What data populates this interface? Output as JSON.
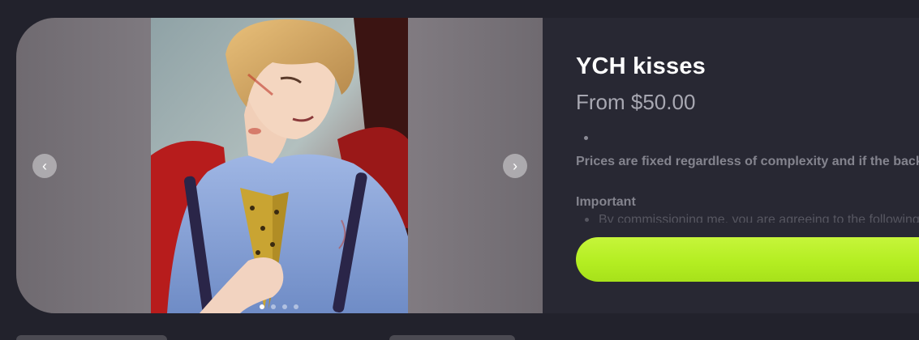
{
  "product": {
    "title": "YCH kisses",
    "price": "From $50.00",
    "description": "Prices are fixed regardless of complexity and if the background is",
    "important_heading": "Important",
    "terms_preview": "By commissioning me, you are agreeing to the following terms"
  },
  "gallery": {
    "prev_icon": "‹",
    "next_icon": "›",
    "dot_count": 4,
    "active_dot": 0
  },
  "colors": {
    "background": "#22222c",
    "card": "#282833",
    "accent": "#b4ee22"
  }
}
